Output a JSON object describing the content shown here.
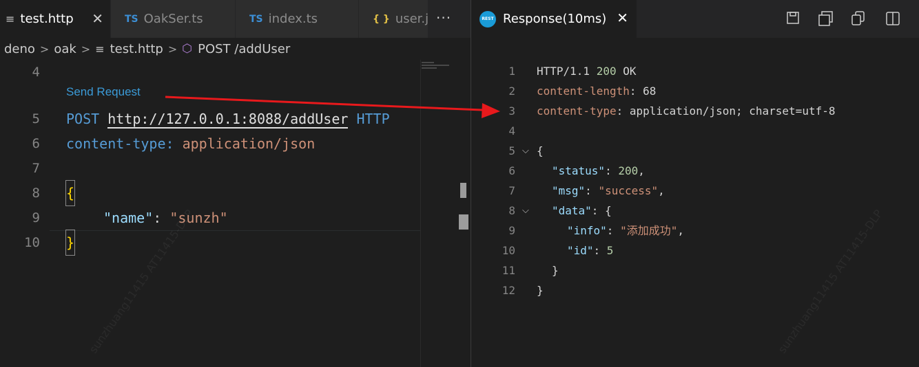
{
  "left": {
    "tabs": [
      {
        "label": "test.http",
        "icon": "lines-icon"
      },
      {
        "label": "OakSer.ts",
        "icon": "ts-icon",
        "icon_text": "TS"
      },
      {
        "label": "index.ts",
        "icon": "ts-icon",
        "icon_text": "TS"
      },
      {
        "label": "user.js",
        "icon": "json-icon",
        "icon_text": "{ }"
      }
    ],
    "more_label": "···",
    "breadcrumb": [
      "deno",
      "oak",
      "test.http",
      "POST /addUser"
    ],
    "codelens": "Send Request",
    "lines": [
      {
        "n": "4"
      },
      {
        "n": "5",
        "method": "POST",
        "url": "http://127.0.0.1:8088/addUser",
        "version": "HTTP"
      },
      {
        "n": "6",
        "key": "content-type:",
        "value": "application/json"
      },
      {
        "n": "7"
      },
      {
        "n": "8",
        "brace": "{"
      },
      {
        "n": "9",
        "prop": "\"name\"",
        "colon": ": ",
        "str": "\"sunzh\""
      },
      {
        "n": "10",
        "brace": "}"
      }
    ]
  },
  "right": {
    "tab_label": "Response(10ms)",
    "logo_text": "REST",
    "lines": [
      {
        "n": "1",
        "a": "HTTP/1.1 ",
        "b": "200",
        "c": " OK"
      },
      {
        "n": "2",
        "h": "content-length",
        "v": ": 68"
      },
      {
        "n": "3",
        "h": "content-type",
        "v": ": application/json; charset=utf-8"
      },
      {
        "n": "4"
      },
      {
        "n": "5",
        "t": "{"
      },
      {
        "n": "6",
        "k": "\"status\"",
        "p": ": ",
        "num": "200",
        "e": ","
      },
      {
        "n": "7",
        "k": "\"msg\"",
        "p": ": ",
        "s": "\"success\"",
        "e": ","
      },
      {
        "n": "8",
        "k": "\"data\"",
        "p": ": {"
      },
      {
        "n": "9",
        "k": "\"info\"",
        "p": ": ",
        "s": "\"添加成功\"",
        "e": ","
      },
      {
        "n": "10",
        "k": "\"id\"",
        "p": ": ",
        "num": "5"
      },
      {
        "n": "11",
        "t": "}"
      },
      {
        "n": "12",
        "t": "}"
      }
    ]
  },
  "watermarks": [
    "sunzhuang11415  AT11415-DLP"
  ],
  "colors": {
    "arrow": "#e8191c",
    "accent": "#569cd6"
  }
}
